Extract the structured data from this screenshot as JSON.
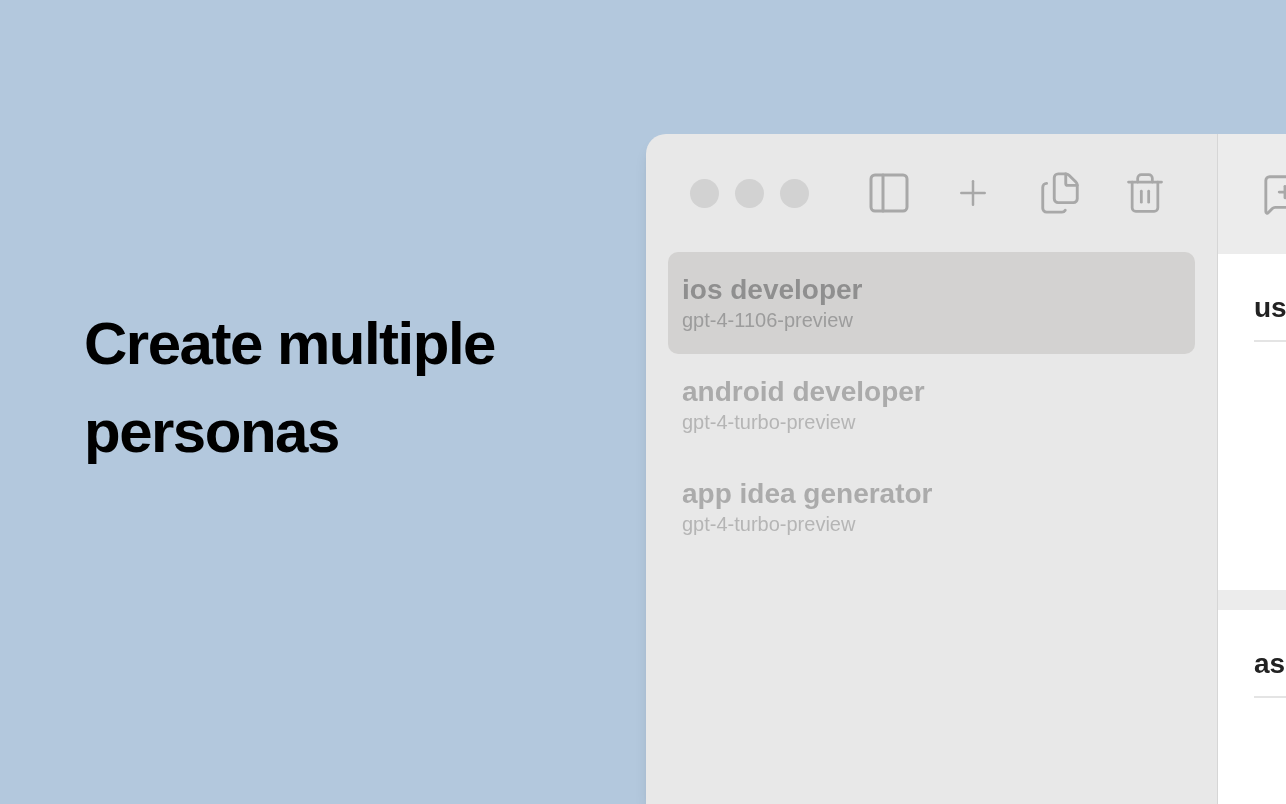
{
  "headline": "Create multiple personas",
  "personas": [
    {
      "name": "ios developer",
      "model": "gpt-4-1106-preview",
      "selected": true
    },
    {
      "name": "android developer",
      "model": "gpt-4-turbo-preview",
      "selected": false
    },
    {
      "name": "app idea generator",
      "model": "gpt-4-turbo-preview",
      "selected": false
    }
  ],
  "messages": [
    {
      "role": "us"
    },
    {
      "role": "as"
    }
  ]
}
